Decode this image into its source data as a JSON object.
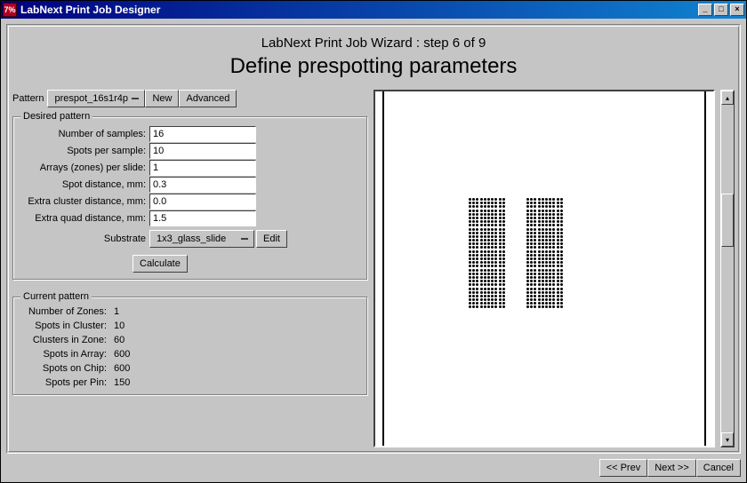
{
  "window": {
    "title": "LabNext Print Job Designer",
    "icon_text": "7%"
  },
  "header": {
    "subtitle": "LabNext Print Job Wizard : step 6 of 9",
    "title": "Define prespotting parameters"
  },
  "toolbar": {
    "pattern_label": "Pattern",
    "pattern_value": "prespot_16s1r4p",
    "new_label": "New",
    "advanced_label": "Advanced"
  },
  "desired": {
    "legend": "Desired pattern",
    "fields": {
      "num_samples": {
        "label": "Number of samples:",
        "value": "16"
      },
      "spots_per_sample": {
        "label": "Spots per sample:",
        "value": "10"
      },
      "arrays_per_slide": {
        "label": "Arrays (zones) per slide:",
        "value": "1"
      },
      "spot_distance": {
        "label": "Spot distance, mm:",
        "value": "0.3"
      },
      "extra_cluster": {
        "label": "Extra cluster distance, mm:",
        "value": "0.0"
      },
      "extra_quad": {
        "label": "Extra quad distance, mm:",
        "value": "1.5"
      }
    },
    "substrate_label": "Substrate",
    "substrate_value": "1x3_glass_slide",
    "edit_label": "Edit",
    "calculate_label": "Calculate"
  },
  "current": {
    "legend": "Current pattern",
    "rows": {
      "zones": {
        "label": "Number of Zones:",
        "value": "1"
      },
      "spots_cluster": {
        "label": "Spots in Cluster:",
        "value": "10"
      },
      "clusters_zone": {
        "label": "Clusters in Zone:",
        "value": "60"
      },
      "spots_array": {
        "label": "Spots in Array:",
        "value": "600"
      },
      "spots_chip": {
        "label": "Spots on Chip:",
        "value": "600"
      },
      "spots_pin": {
        "label": "Spots per Pin:",
        "value": "150"
      }
    }
  },
  "footer": {
    "prev": "<<  Prev",
    "next": "Next  >>",
    "cancel": "Cancel"
  }
}
